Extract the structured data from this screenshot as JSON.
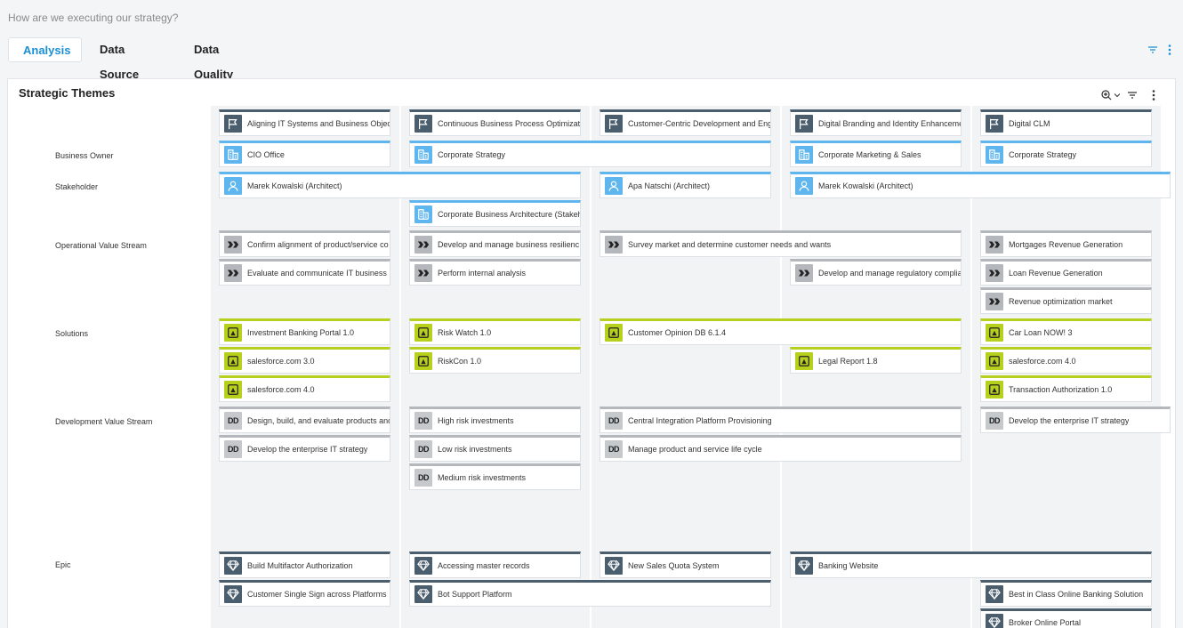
{
  "page": {
    "title": "How are we executing our strategy?"
  },
  "tabs": [
    {
      "label": "Analysis",
      "active": true
    },
    {
      "label": "Data Source",
      "active": false
    },
    {
      "label": "Data Quality",
      "active": false
    }
  ],
  "header_icons": [
    "filter-icon",
    "more-vertical-icon"
  ],
  "panel": {
    "title": "Strategic Themes",
    "toolbar_icons": [
      "zoom-icon",
      "chevron-down-icon",
      "filter-icon",
      "more-vertical-icon"
    ]
  },
  "colors": {
    "accent": "#1a8fd6",
    "theme": "#4b5e6e",
    "org": "#5fb6ee",
    "solution": "#b7cf1d",
    "value_stream": "#b4b8bc"
  },
  "themes": [
    "Aligning IT Systems and Business Objec",
    "Continuous Business Process Optimizati",
    "Customer-Centric Development and Eng",
    "Digital Branding and Identity Enhanceme",
    "Digital CLM"
  ],
  "rows": [
    {
      "label": "Business Owner"
    },
    {
      "label": "Stakeholder"
    },
    {
      "label": "Operational Value Stream"
    },
    {
      "label": "Solutions"
    },
    {
      "label": "Development Value Stream"
    },
    {
      "label": "Epic"
    }
  ],
  "business_owner": [
    "CIO Office",
    "Corporate Strategy",
    "Corporate Marketing & Sales",
    "Corporate Strategy"
  ],
  "stakeholder": [
    "Marek Kowalski (Architect)",
    "Apa Natschi (Architect)",
    "Marek Kowalski (Architect)",
    "Corporate Business Architecture (Stakeh"
  ],
  "ovs": [
    "Confirm alignment of product/service co",
    "Evaluate and communicate IT business",
    "Develop and manage business resilienc",
    "Perform internal analysis",
    "Survey market and determine customer needs and wants",
    "Develop and manage regulatory complia",
    "Mortgages Revenue Generation",
    "Loan Revenue Generation",
    "Revenue optimization market"
  ],
  "solutions": [
    "Investment Banking Portal 1.0",
    "salesforce.com 3.0",
    "salesforce.com 4.0",
    "Risk Watch 1.0",
    "RiskCon 1.0",
    "Customer Opinion DB 6.1.4",
    "Legal Report 1.8",
    "Car Loan NOW! 3",
    "salesforce.com 4.0",
    "Transaction Authorization 1.0"
  ],
  "dvs_icon_text": "DD",
  "dvs": [
    "Design, build, and evaluate products and",
    "Develop the enterprise IT strategy",
    "High risk investments",
    "Low risk investments",
    "Medium risk investments",
    "Central Integration Platform Provisioning",
    "Manage product and service life cycle",
    "Develop the enterprise IT strategy"
  ],
  "epics": [
    "Build Multifactor Authorization",
    "Customer Single Sign across Platforms",
    "Accessing master records",
    "Bot Support Platform",
    "New Sales Quota System",
    "Banking Website",
    "Best in Class Online Banking Solution",
    "Broker Online Portal"
  ]
}
